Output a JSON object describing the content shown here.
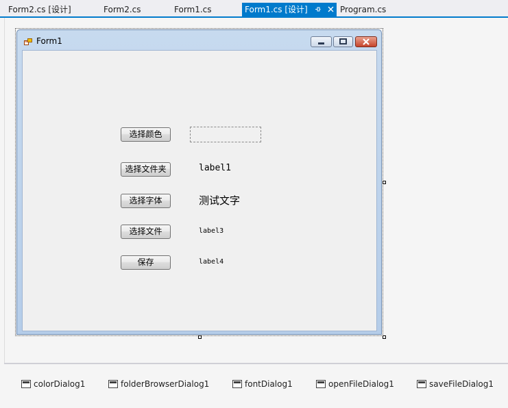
{
  "tabs": [
    {
      "label": "Form2.cs [设计]",
      "active": false
    },
    {
      "label": "Form2.cs",
      "active": false
    },
    {
      "label": "Form1.cs",
      "active": false
    },
    {
      "label": "Form1.cs [设计]",
      "active": true
    },
    {
      "label": "Program.cs",
      "active": false
    }
  ],
  "tab_pin_icon": "pin-icon",
  "tab_close_icon": "close-icon",
  "form": {
    "title": "Form1",
    "buttons": {
      "color": "选择颜色",
      "folder": "选择文件夹",
      "font": "选择字体",
      "file": "选择文件",
      "save": "保存"
    },
    "labels": {
      "label1": "label1",
      "font_sample": "测试文字",
      "label3": "label3",
      "label4": "label4"
    }
  },
  "tray": [
    {
      "name": "colorDialog1",
      "icon": "color-dialog-icon"
    },
    {
      "name": "folderBrowserDialog1",
      "icon": "folder-browser-dialog-icon"
    },
    {
      "name": "fontDialog1",
      "icon": "font-dialog-icon"
    },
    {
      "name": "openFileDialog1",
      "icon": "open-file-dialog-icon"
    },
    {
      "name": "saveFileDialog1",
      "icon": "save-file-dialog-icon"
    }
  ],
  "colors": {
    "accent": "#007acc",
    "tab_active_text": "#ffffff"
  }
}
